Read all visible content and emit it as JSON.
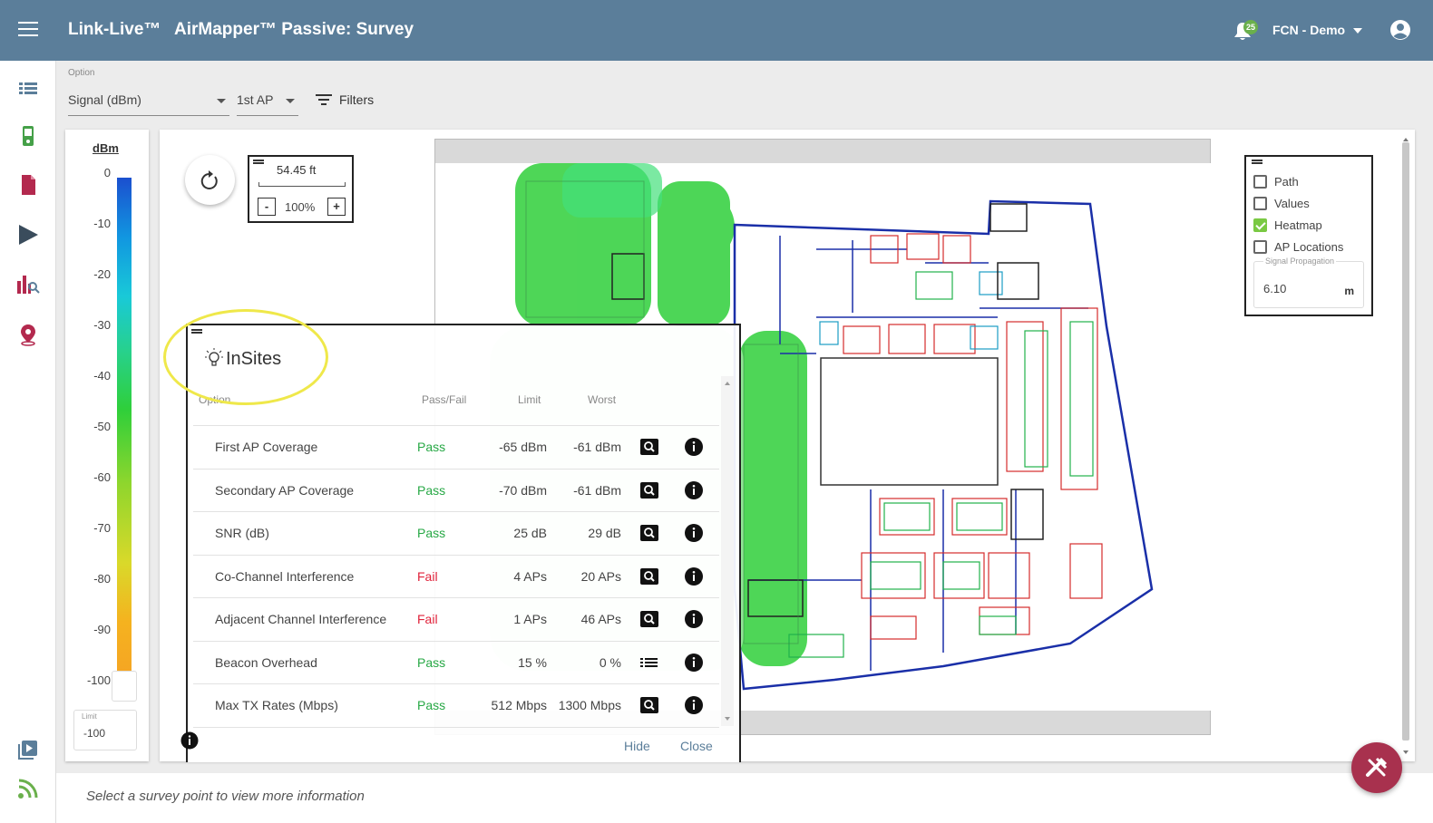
{
  "header": {
    "brand": "Link-Live™",
    "app_title": "AirMapper™ Passive: Survey",
    "notification_count": "25",
    "org": "FCN - Demo"
  },
  "nav": {
    "icons": [
      "list-icon",
      "tester-device-icon",
      "document-icon",
      "play-icon",
      "chart-search-icon",
      "location-pin-icon",
      "video-library-icon",
      "signal-wave-icon"
    ]
  },
  "options": {
    "label": "Option",
    "signal_select": "Signal (dBm)",
    "ap_select": "1st AP",
    "filters": "Filters"
  },
  "scale": {
    "unit": "dBm",
    "ticks": [
      "0",
      "-10",
      "-20",
      "-30",
      "-40",
      "-50",
      "-60",
      "-70",
      "-80",
      "-90",
      "-100"
    ],
    "limit_label": "Limit",
    "limit_value": "-100"
  },
  "map": {
    "distance": "54.45 ft",
    "zoom": "100%",
    "zoom_out": "-",
    "zoom_in": "+"
  },
  "layers": {
    "items": [
      {
        "label": "Path",
        "checked": false
      },
      {
        "label": "Values",
        "checked": false
      },
      {
        "label": "Heatmap",
        "checked": true
      },
      {
        "label": "AP Locations",
        "checked": false
      }
    ],
    "propagation_label": "Signal Propagation",
    "propagation_value": "6.10",
    "propagation_unit": "m"
  },
  "insites": {
    "title": "InSites",
    "headers": {
      "option": "Option",
      "passfail": "Pass/Fail",
      "limit": "Limit",
      "worst": "Worst"
    },
    "rows": [
      {
        "option": "First AP Coverage",
        "result": "Pass",
        "limit": "-65 dBm",
        "worst": "-61 dBm",
        "action": "search"
      },
      {
        "option": "Secondary AP Coverage",
        "result": "Pass",
        "limit": "-70 dBm",
        "worst": "-61 dBm",
        "action": "search"
      },
      {
        "option": "SNR (dB)",
        "result": "Pass",
        "limit": "25 dB",
        "worst": "29 dB",
        "action": "search"
      },
      {
        "option": "Co-Channel Interference",
        "result": "Fail",
        "limit": "4 APs",
        "worst": "20 APs",
        "action": "search"
      },
      {
        "option": "Adjacent Channel Interference",
        "result": "Fail",
        "limit": "1 APs",
        "worst": "46 APs",
        "action": "search"
      },
      {
        "option": "Beacon Overhead",
        "result": "Pass",
        "limit": "15 %",
        "worst": "0 %",
        "action": "list"
      },
      {
        "option": "Max TX Rates (Mbps)",
        "result": "Pass",
        "limit": "512 Mbps",
        "worst": "1300 Mbps",
        "action": "search"
      }
    ],
    "hide": "Hide",
    "close": "Close"
  },
  "status": {
    "message": "Select a survey point to view more information"
  },
  "colors": {
    "header": "#5b7e9a",
    "pass": "#27a845",
    "fail": "#e0233b",
    "fab": "#a8314e",
    "nav_icon": "#5b7e9a",
    "heatmap": "#2fcf3a"
  }
}
